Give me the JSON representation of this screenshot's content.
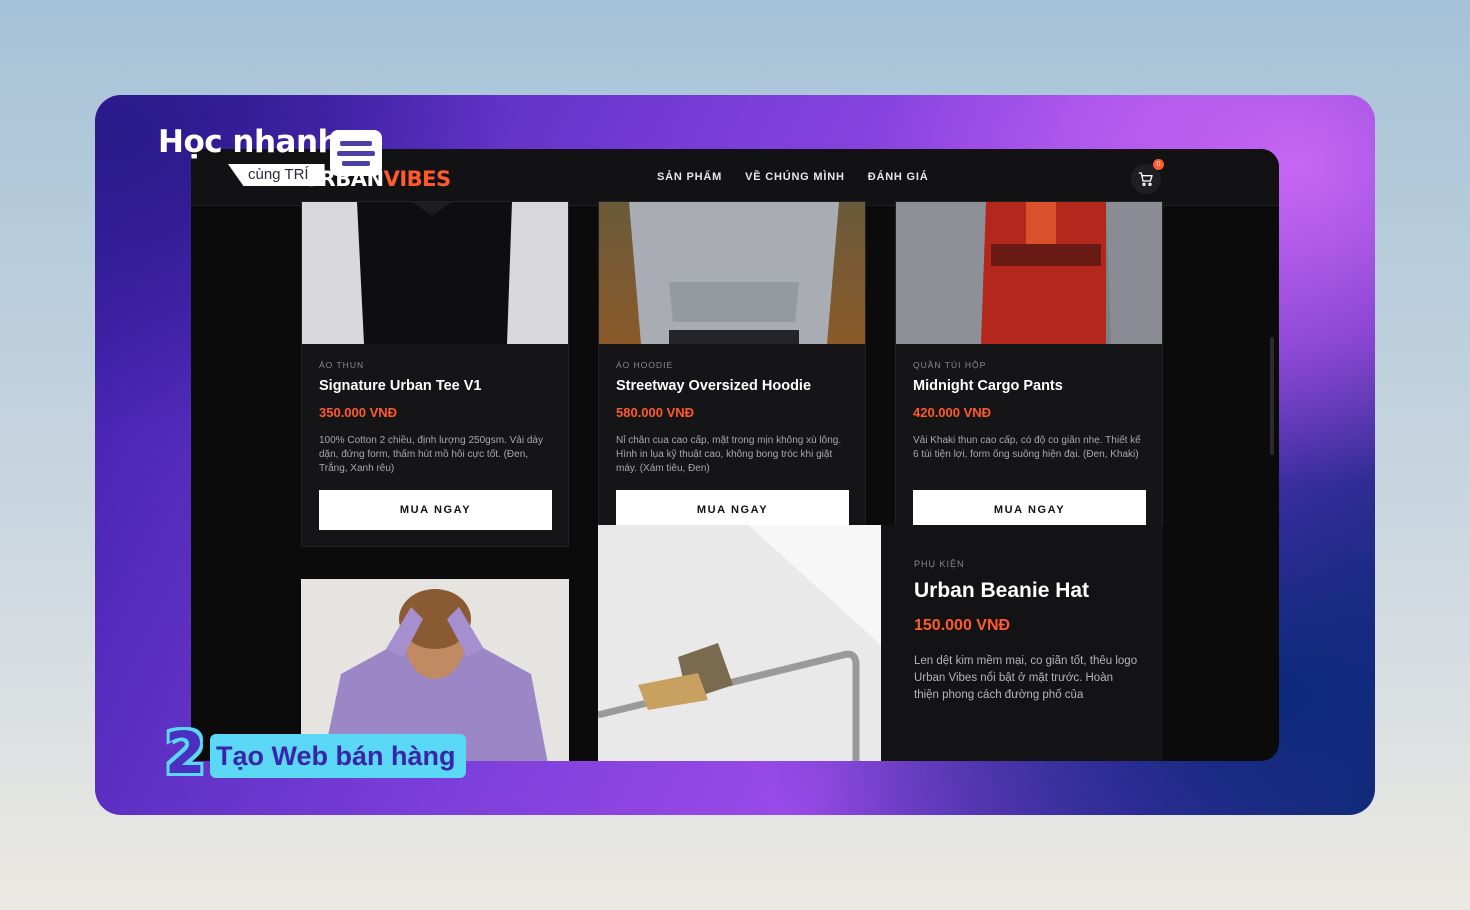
{
  "brand": {
    "name_white": "URBAN",
    "name_accent": "VIBES"
  },
  "nav": [
    "SẢN PHẨM",
    "VỀ CHÚNG MÌNH",
    "ĐÁNH GIÁ"
  ],
  "cart": {
    "count": "0"
  },
  "products": [
    {
      "category": "ÁO THUN",
      "title": "Signature Urban Tee V1",
      "price": "350.000 VNĐ",
      "description": "100% Cotton 2 chiều, định lượng 250gsm. Vải dày dặn, đứng form, thấm hút mồ hôi cực tốt. (Đen, Trắng, Xanh rêu)",
      "button": "MUA NGAY"
    },
    {
      "category": "ÁO HOODIE",
      "title": "Streetway Oversized Hoodie",
      "price": "580.000 VNĐ",
      "description": "Nỉ chân cua cao cấp, mặt trong mịn không xù lông. Hình in lụa kỹ thuật cao, không bong tróc khi giặt máy. (Xám tiêu, Đen)",
      "button": "MUA NGAY"
    },
    {
      "category": "QUẦN TÚI HỘP",
      "title": "Midnight Cargo Pants",
      "price": "420.000 VNĐ",
      "description": "Vải Khaki thun cao cấp, có độ co giãn nhẹ. Thiết kế 6 túi tiện lợi, form ống suông hiện đại. (Đen, Khaki)",
      "button": "MUA NGAY"
    }
  ],
  "featured": {
    "category": "PHỤ KIỆN",
    "title": "Urban Beanie Hat",
    "price": "150.000 VNĐ",
    "description": "Len dệt kim mềm mại, co giãn tốt, thêu logo Urban Vibes nổi bật ở mặt trước. Hoàn thiện phong cách đường phố của"
  },
  "overlay": {
    "course_title": "Học nhanh",
    "course_sub": "cùng TRÍ",
    "lesson_number": "2",
    "lesson_label": "Tạo Web bán hàng"
  },
  "colors": {
    "accent": "#ff5a2c",
    "background": "#0b0b0c",
    "card": "#151517"
  }
}
